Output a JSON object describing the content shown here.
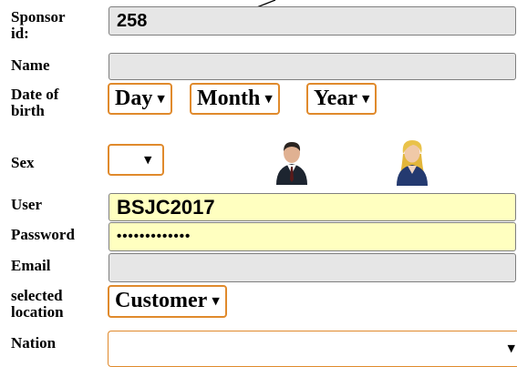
{
  "form": {
    "sponsor": {
      "label_line1": "Sponsor",
      "label_line2": "id:",
      "value": "258"
    },
    "name": {
      "label": "Name",
      "value": ""
    },
    "dob": {
      "label_line1": "Date of",
      "label_line2": "birth",
      "day": "Day",
      "month": "Month",
      "year": "Year"
    },
    "sex": {
      "label": "Sex",
      "value": "",
      "icons": [
        "male-user-icon",
        "female-user-icon"
      ]
    },
    "user": {
      "label": "User",
      "value": "BSJC2017"
    },
    "password": {
      "label": "Password",
      "value": "•••••••••••••"
    },
    "email": {
      "label": "Email",
      "value": ""
    },
    "location": {
      "label_line1": "selected",
      "label_line2": "location",
      "value": "Customer"
    },
    "nation": {
      "label": "Nation",
      "value": ""
    }
  },
  "colors": {
    "select_border": "#e08a2c",
    "field_grey": "#e6e6e6",
    "field_yellow": "#ffffc0"
  }
}
